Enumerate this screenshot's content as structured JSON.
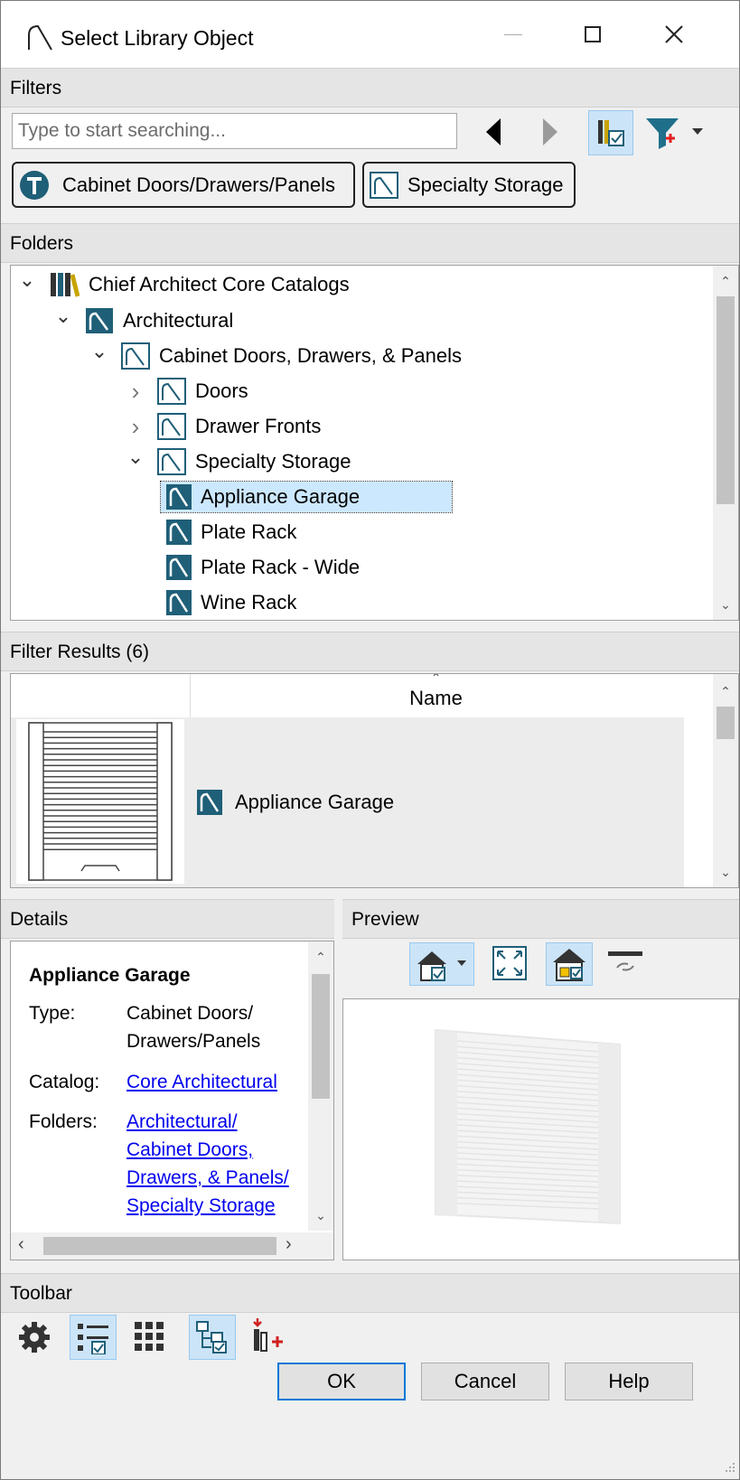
{
  "window": {
    "title": "Select Library Object"
  },
  "filters": {
    "header": "Filters",
    "search_placeholder": "Type to start searching...",
    "chips": [
      "Cabinet Doors/Drawers/Panels",
      "Specialty Storage"
    ]
  },
  "folders": {
    "header": "Folders",
    "items": [
      {
        "label": "Chief Architect Core Catalogs",
        "icon": "library-books-icon",
        "expand": "open"
      },
      {
        "label": "Architectural",
        "icon": "catalog-folder-icon",
        "expand": "open"
      },
      {
        "label": "Cabinet Doors, Drawers, & Panels",
        "icon": "folder-outline-icon",
        "expand": "open"
      },
      {
        "label": "Doors",
        "icon": "folder-outline-icon",
        "expand": "closed"
      },
      {
        "label": "Drawer Fronts",
        "icon": "folder-outline-icon",
        "expand": "closed"
      },
      {
        "label": "Specialty Storage",
        "icon": "folder-outline-icon",
        "expand": "open"
      },
      {
        "label": "Appliance Garage",
        "icon": "library-object-icon",
        "expand": "none"
      },
      {
        "label": "Plate Rack",
        "icon": "library-object-icon",
        "expand": "none"
      },
      {
        "label": "Plate Rack - Wide",
        "icon": "library-object-icon",
        "expand": "none"
      },
      {
        "label": "Wine Rack",
        "icon": "library-object-icon",
        "expand": "none"
      }
    ]
  },
  "results": {
    "header": "Filter Results (6)",
    "column_name": "Name",
    "rows": [
      {
        "name": "Appliance Garage"
      }
    ]
  },
  "details": {
    "header": "Details",
    "name": "Appliance Garage",
    "type_label": "Type:",
    "type_value_1": "Cabinet Doors/",
    "type_value_2": "Drawers/Panels",
    "catalog_label": "Catalog:",
    "catalog_value": "Core Architectural",
    "folders_label": "Folders:",
    "folders_value": [
      "Architectural/",
      "Cabinet Doors,",
      "Drawers, & Panels/",
      "Specialty Storage"
    ]
  },
  "preview": {
    "header": "Preview"
  },
  "toolbar": {
    "header": "Toolbar",
    "ok": "OK",
    "cancel": "Cancel",
    "help": "Help"
  },
  "colors": {
    "accent": "#0078d7",
    "selected_bg": "#cce8ff",
    "catalog_icon": "#1f5f78"
  }
}
